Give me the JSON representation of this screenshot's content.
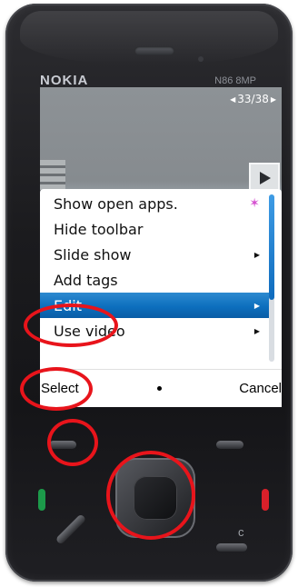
{
  "device": {
    "brand": "NOKIA",
    "model": "N86 8MP",
    "clear_key_label": "c"
  },
  "gallery": {
    "counter": "33/38"
  },
  "menu": {
    "items": [
      {
        "label": "Show open apps.",
        "has_submenu": false,
        "trailing_icon": "open-apps-icon"
      },
      {
        "label": "Hide toolbar",
        "has_submenu": false
      },
      {
        "label": "Slide show",
        "has_submenu": true
      },
      {
        "label": "Add tags",
        "has_submenu": false
      },
      {
        "label": "Edit",
        "has_submenu": true,
        "selected": true
      },
      {
        "label": "Use video",
        "has_submenu": true
      }
    ]
  },
  "softkeys": {
    "left": "Select",
    "right": "Cancel"
  },
  "colors": {
    "highlight": "#0d6fbe",
    "annotation": "#e8141b",
    "call_green": "#1c9a4a",
    "end_red": "#d9202a"
  }
}
